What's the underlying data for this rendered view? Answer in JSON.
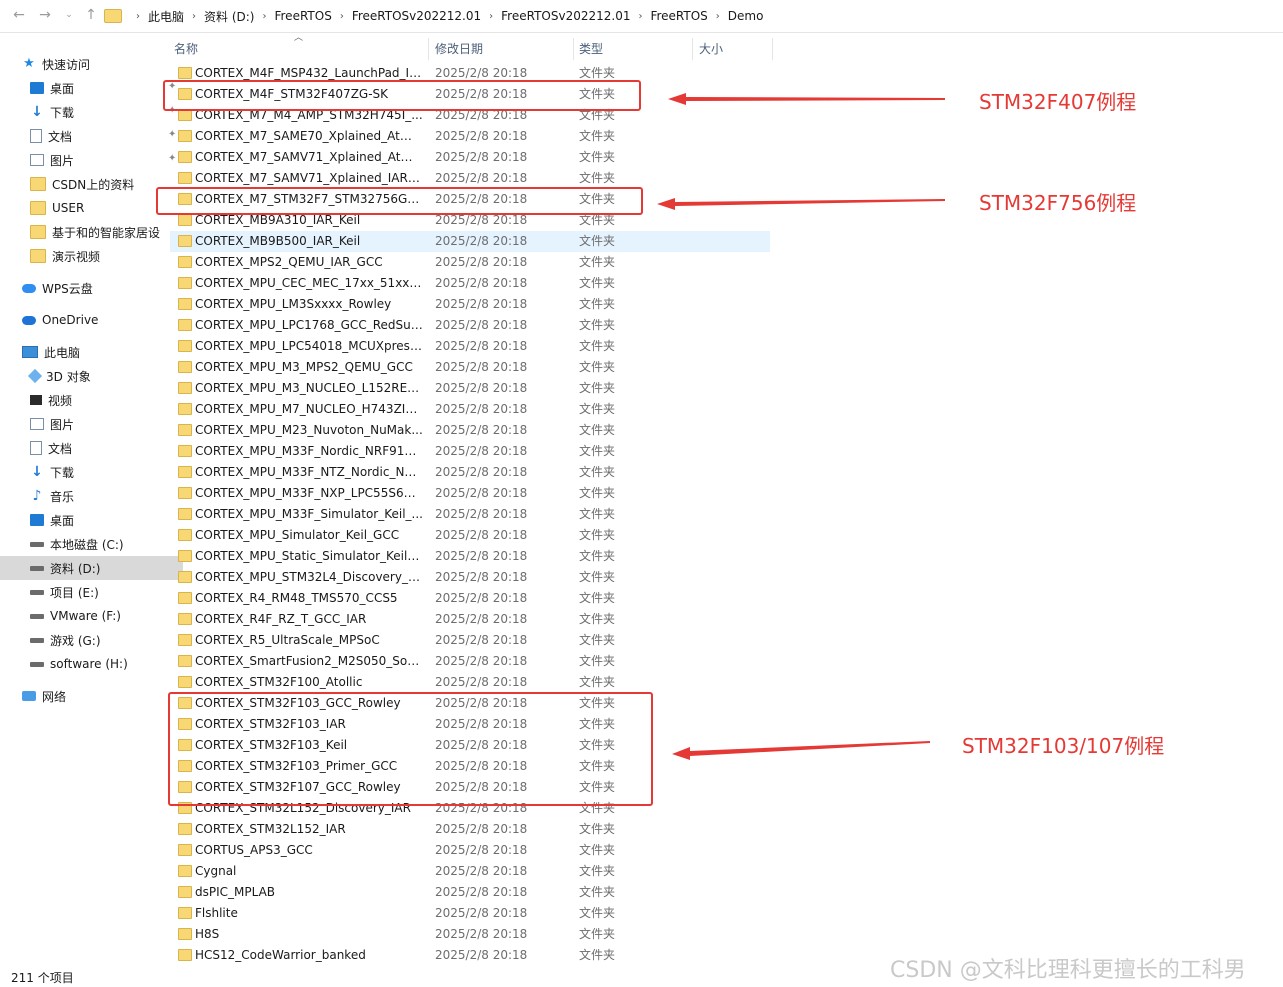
{
  "breadcrumb": [
    "此电脑",
    "资料 (D:)",
    "FreeRTOS",
    "FreeRTOSv202212.01",
    "FreeRTOSv202212.01",
    "FreeRTOS",
    "Demo"
  ],
  "sidebar": {
    "quick_access": "快速访问",
    "items": [
      "桌面",
      "下载",
      "文档",
      "图片",
      "CSDN上的资料",
      "USER",
      "基于和的智能家居设",
      "演示视频"
    ],
    "wps": "WPS云盘",
    "onedrive": "OneDrive",
    "this_pc": "此电脑",
    "pc_items": [
      "3D 对象",
      "视频",
      "图片",
      "文档",
      "下载",
      "音乐",
      "桌面",
      "本地磁盘 (C:)",
      "资料 (D:)",
      "项目 (E:)",
      "VMware (F:)",
      "游戏 (G:)",
      "software (H:)"
    ],
    "network": "网络"
  },
  "columns": {
    "name": "名称",
    "date": "修改日期",
    "type": "类型",
    "size": "大小"
  },
  "files": [
    {
      "name": "CORTEX_M4F_MSP432_LaunchPad_IA...",
      "date": "2025/2/8 20:18",
      "type": "文件夹"
    },
    {
      "name": "CORTEX_M4F_STM32F407ZG-SK",
      "date": "2025/2/8 20:18",
      "type": "文件夹"
    },
    {
      "name": "CORTEX_M7_M4_AMP_STM32H745I_...",
      "date": "2025/2/8 20:18",
      "type": "文件夹"
    },
    {
      "name": "CORTEX_M7_SAME70_Xplained_Atme...",
      "date": "2025/2/8 20:18",
      "type": "文件夹"
    },
    {
      "name": "CORTEX_M7_SAMV71_Xplained_Atme...",
      "date": "2025/2/8 20:18",
      "type": "文件夹"
    },
    {
      "name": "CORTEX_M7_SAMV71_Xplained_IAR_...",
      "date": "2025/2/8 20:18",
      "type": "文件夹"
    },
    {
      "name": "CORTEX_M7_STM32F7_STM32756G-E...",
      "date": "2025/2/8 20:18",
      "type": "文件夹"
    },
    {
      "name": "CORTEX_MB9A310_IAR_Keil",
      "date": "2025/2/8 20:18",
      "type": "文件夹"
    },
    {
      "name": "CORTEX_MB9B500_IAR_Keil",
      "date": "2025/2/8 20:18",
      "type": "文件夹"
    },
    {
      "name": "CORTEX_MPS2_QEMU_IAR_GCC",
      "date": "2025/2/8 20:18",
      "type": "文件夹"
    },
    {
      "name": "CORTEX_MPU_CEC_MEC_17xx_51xx_K...",
      "date": "2025/2/8 20:18",
      "type": "文件夹"
    },
    {
      "name": "CORTEX_MPU_LM3Sxxxx_Rowley",
      "date": "2025/2/8 20:18",
      "type": "文件夹"
    },
    {
      "name": "CORTEX_MPU_LPC1768_GCC_RedSuite",
      "date": "2025/2/8 20:18",
      "type": "文件夹"
    },
    {
      "name": "CORTEX_MPU_LPC54018_MCUXpresso",
      "date": "2025/2/8 20:18",
      "type": "文件夹"
    },
    {
      "name": "CORTEX_MPU_M3_MPS2_QEMU_GCC",
      "date": "2025/2/8 20:18",
      "type": "文件夹"
    },
    {
      "name": "CORTEX_MPU_M3_NUCLEO_L152RE_...",
      "date": "2025/2/8 20:18",
      "type": "文件夹"
    },
    {
      "name": "CORTEX_MPU_M7_NUCLEO_H743ZI2...",
      "date": "2025/2/8 20:18",
      "type": "文件夹"
    },
    {
      "name": "CORTEX_MPU_M23_Nuvoton_NuMak...",
      "date": "2025/2/8 20:18",
      "type": "文件夹"
    },
    {
      "name": "CORTEX_MPU_M33F_Nordic_NRF916...",
      "date": "2025/2/8 20:18",
      "type": "文件夹"
    },
    {
      "name": "CORTEX_MPU_M33F_NTZ_Nordic_NR...",
      "date": "2025/2/8 20:18",
      "type": "文件夹"
    },
    {
      "name": "CORTEX_MPU_M33F_NXP_LPC55S69_...",
      "date": "2025/2/8 20:18",
      "type": "文件夹"
    },
    {
      "name": "CORTEX_MPU_M33F_Simulator_Keil_...",
      "date": "2025/2/8 20:18",
      "type": "文件夹"
    },
    {
      "name": "CORTEX_MPU_Simulator_Keil_GCC",
      "date": "2025/2/8 20:18",
      "type": "文件夹"
    },
    {
      "name": "CORTEX_MPU_Static_Simulator_Keil_G...",
      "date": "2025/2/8 20:18",
      "type": "文件夹"
    },
    {
      "name": "CORTEX_MPU_STM32L4_Discovery_G...",
      "date": "2025/2/8 20:18",
      "type": "文件夹"
    },
    {
      "name": "CORTEX_R4_RM48_TMS570_CCS5",
      "date": "2025/2/8 20:18",
      "type": "文件夹"
    },
    {
      "name": "CORTEX_R4F_RZ_T_GCC_IAR",
      "date": "2025/2/8 20:18",
      "type": "文件夹"
    },
    {
      "name": "CORTEX_R5_UltraScale_MPSoC",
      "date": "2025/2/8 20:18",
      "type": "文件夹"
    },
    {
      "name": "CORTEX_SmartFusion2_M2S050_Soft...",
      "date": "2025/2/8 20:18",
      "type": "文件夹"
    },
    {
      "name": "CORTEX_STM32F100_Atollic",
      "date": "2025/2/8 20:18",
      "type": "文件夹"
    },
    {
      "name": "CORTEX_STM32F103_GCC_Rowley",
      "date": "2025/2/8 20:18",
      "type": "文件夹"
    },
    {
      "name": "CORTEX_STM32F103_IAR",
      "date": "2025/2/8 20:18",
      "type": "文件夹"
    },
    {
      "name": "CORTEX_STM32F103_Keil",
      "date": "2025/2/8 20:18",
      "type": "文件夹"
    },
    {
      "name": "CORTEX_STM32F103_Primer_GCC",
      "date": "2025/2/8 20:18",
      "type": "文件夹"
    },
    {
      "name": "CORTEX_STM32F107_GCC_Rowley",
      "date": "2025/2/8 20:18",
      "type": "文件夹"
    },
    {
      "name": "CORTEX_STM32L152_Discovery_IAR",
      "date": "2025/2/8 20:18",
      "type": "文件夹"
    },
    {
      "name": "CORTEX_STM32L152_IAR",
      "date": "2025/2/8 20:18",
      "type": "文件夹"
    },
    {
      "name": "CORTUS_APS3_GCC",
      "date": "2025/2/8 20:18",
      "type": "文件夹"
    },
    {
      "name": "Cygnal",
      "date": "2025/2/8 20:18",
      "type": "文件夹"
    },
    {
      "name": "dsPIC_MPLAB",
      "date": "2025/2/8 20:18",
      "type": "文件夹"
    },
    {
      "name": "Flshlite",
      "date": "2025/2/8 20:18",
      "type": "文件夹"
    },
    {
      "name": "H8S",
      "date": "2025/2/8 20:18",
      "type": "文件夹"
    },
    {
      "name": "HCS12_CodeWarrior_banked",
      "date": "2025/2/8 20:18",
      "type": "文件夹"
    }
  ],
  "annotations": [
    "STM32F407例程",
    "STM32F756例程",
    "STM32F103/107例程"
  ],
  "status": "211 个项目",
  "watermark": "CSDN @文科比理科更擅长的工科男",
  "colors": {
    "annotation": "#e53935",
    "selected_row": "#e5f3ff",
    "folder": "#f8d775"
  }
}
